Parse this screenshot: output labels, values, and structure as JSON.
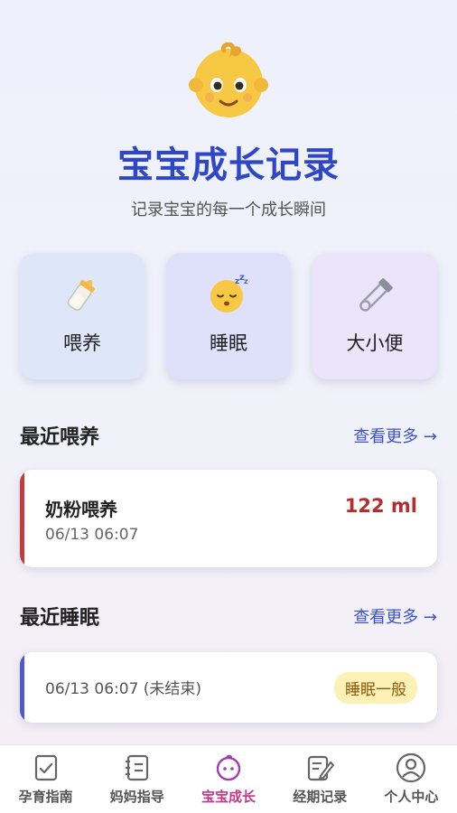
{
  "header": {
    "title": "宝宝成长记录",
    "subtitle": "记录宝宝的每一个成长瞬间",
    "face_icon": "baby-face-icon"
  },
  "quick_actions": [
    {
      "label": "喂养",
      "icon": "baby-bottle-icon"
    },
    {
      "label": "睡眠",
      "icon": "sleeping-face-icon"
    },
    {
      "label": "大小便",
      "icon": "safety-pin-icon"
    }
  ],
  "recent_feeding": {
    "title": "最近喂养",
    "more": "查看更多 →",
    "record": {
      "name": "奶粉喂养",
      "time": "06/13 06:07",
      "amount": "122 ml"
    }
  },
  "recent_sleep": {
    "title": "最近睡眠",
    "more": "查看更多 →",
    "record": {
      "time": "06/13 06:07 (未结束)",
      "quality": "睡眠一般"
    }
  },
  "tabs": [
    {
      "label": "孕育指南",
      "icon": "checklist-icon",
      "active": false
    },
    {
      "label": "妈妈指导",
      "icon": "notebook-icon",
      "active": false
    },
    {
      "label": "宝宝成长",
      "icon": "baby-icon",
      "active": true
    },
    {
      "label": "经期记录",
      "icon": "edit-note-icon",
      "active": false
    },
    {
      "label": "个人中心",
      "icon": "user-icon",
      "active": false
    }
  ],
  "colors": {
    "accent": "#2f47c4",
    "feed_bar": "#c53a3a",
    "sleep_bar": "#4c58d4",
    "active_tab": "#c03a86"
  }
}
